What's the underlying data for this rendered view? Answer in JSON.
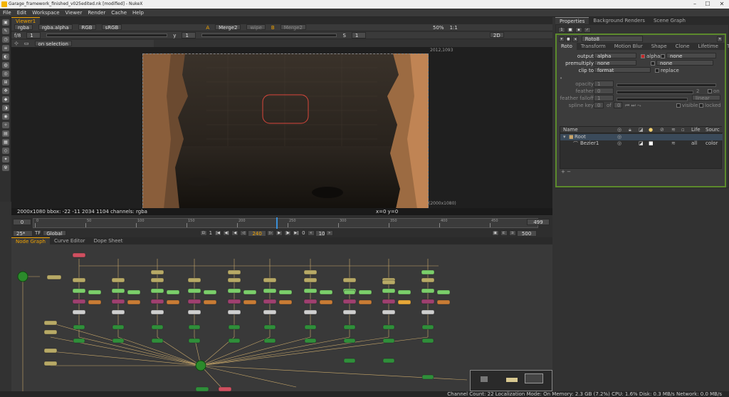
{
  "window": {
    "title": "Garage_framework_finished_v025edited.nk [modified] - NukeX",
    "minimize": "–",
    "maximize": "☐",
    "close": "✕"
  },
  "menu": [
    "File",
    "Edit",
    "Workspace",
    "Viewer",
    "Render",
    "Cache",
    "Help"
  ],
  "viewer": {
    "tab_label": "Viewer1",
    "channel_set": "rgba",
    "channel": "rgba.alpha",
    "colorspace_mode": "RGB",
    "lut": "sRGB",
    "a_input": "A",
    "a_node": "Merge2",
    "wipe_mode": "wipe",
    "b_input": "B",
    "b_node": "Merge2",
    "zoom": "50%",
    "ratio": "1:1",
    "fstop": "f/8",
    "gain_value": "1",
    "y_label": "y",
    "gamma_value": "1",
    "s_label": "S",
    "s_value": "1",
    "view_mode": "2D",
    "overlay_mode": "on selection",
    "format_top": "2012,1093",
    "format_bottom": "(2000x1080)",
    "status_left": "2000x1080  bbox: -22 -11 2034 1104 channels: rgba",
    "status_right": "x=0 y=0"
  },
  "timeline": {
    "start": "0",
    "end": "499",
    "fps": "25*",
    "tf": "TF",
    "scope": "Global",
    "current_frame": "240",
    "increment": "10",
    "end_frame": "500",
    "frame_counter_left": "1",
    "skip_value": "0",
    "ticks": [
      "0",
      "50",
      "100",
      "150",
      "200",
      "250",
      "300",
      "350",
      "400",
      "450"
    ]
  },
  "node_graph_tabs": [
    "Node Graph",
    "Curve Editor",
    "Dope Sheet"
  ],
  "right_tabs": [
    "Properties",
    "Background Renders",
    "Scene Graph"
  ],
  "properties": {
    "node_name": "Roto8",
    "tabs": [
      "Roto",
      "Transform",
      "Motion Blur",
      "Shape",
      "Clone",
      "Lifetime",
      "Tra"
    ],
    "output_label": "output",
    "output_value": "alpha",
    "output_alpha": "alpha",
    "output_none": "none",
    "premultiply_label": "premultiply",
    "premultiply_value": "none",
    "premultiply_none": "none",
    "clip_to_label": "clip to",
    "clip_to_value": "format",
    "replace_label": "replace",
    "opacity_label": "opacity",
    "opacity_value": "1",
    "feather_label": "feather",
    "feather_value": "0",
    "feather_num": "2",
    "feather_on": "on",
    "feather_falloff_label": "feather falloff",
    "feather_falloff_value": "1",
    "falloff_type": "linear",
    "spline_key_label": "spline key",
    "spline_key_value": "0",
    "spline_key_of": "of",
    "spline_key_total": "0",
    "visible_label": "visible",
    "locked_label": "locked",
    "tree_headers": [
      "Name",
      "Life",
      "Sourc"
    ],
    "tree_rows": [
      {
        "name": "Root",
        "life": "",
        "source": ""
      },
      {
        "name": "Bezier1",
        "life": "all",
        "source": "color"
      }
    ]
  },
  "status_bar": "Channel Count: 22  Localization Mode: On  Memory: 2.3 GB (7.2%)  CPU: 1.6%  Disk: 0.3 MB/s  Network: 0.0 MB/s",
  "colors": {
    "accent": "#f2a300",
    "selected_node_border": "#5c8a2c",
    "roto_shape": "#d9463b"
  }
}
